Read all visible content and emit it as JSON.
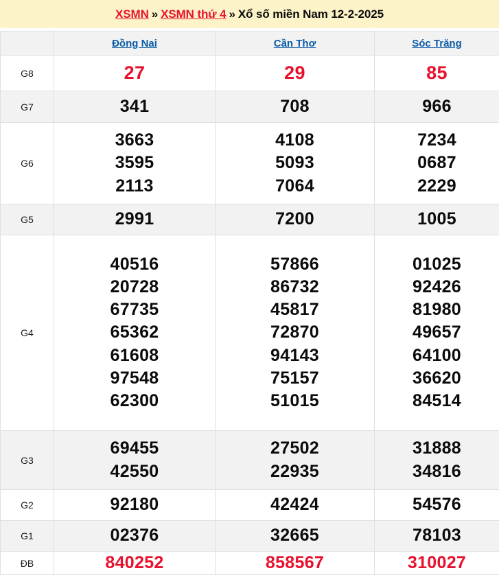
{
  "banner": {
    "link1": "XSMN",
    "sep1": "»",
    "link2": "XSMN thứ 4",
    "sep2": "»",
    "title": "Xổ số miền Nam 12-2-2025"
  },
  "colors": {
    "banner_bg": "#fdf3c8",
    "crumb_link": "#e8112d",
    "province_link": "#0b5ca8",
    "accent_number": "#e8112d",
    "number": "#0b0b0b",
    "row_alt_bg": "#f2f2f2",
    "row_bg": "#ffffff",
    "border": "#e0e0e0"
  },
  "table": {
    "corner_label": "",
    "provinces": [
      "Đồng Nai",
      "Cần Thơ",
      "Sóc Trăng"
    ],
    "rows": [
      {
        "label": "G8",
        "accent": true,
        "stripe": false,
        "values": [
          [
            "27"
          ],
          [
            "29"
          ],
          [
            "85"
          ]
        ]
      },
      {
        "label": "G7",
        "accent": false,
        "stripe": true,
        "values": [
          [
            "341"
          ],
          [
            "708"
          ],
          [
            "966"
          ]
        ]
      },
      {
        "label": "G6",
        "accent": false,
        "stripe": false,
        "values": [
          [
            "3663",
            "3595",
            "2113"
          ],
          [
            "4108",
            "5093",
            "7064"
          ],
          [
            "7234",
            "0687",
            "2229"
          ]
        ]
      },
      {
        "label": "G5",
        "accent": false,
        "stripe": true,
        "values": [
          [
            "2991"
          ],
          [
            "7200"
          ],
          [
            "1005"
          ]
        ]
      },
      {
        "label": "G4",
        "accent": false,
        "stripe": false,
        "values": [
          [
            "40516",
            "20728",
            "67735",
            "65362",
            "61608",
            "97548",
            "62300"
          ],
          [
            "57866",
            "86732",
            "45817",
            "72870",
            "94143",
            "75157",
            "51015"
          ],
          [
            "01025",
            "92426",
            "81980",
            "49657",
            "64100",
            "36620",
            "84514"
          ]
        ]
      },
      {
        "label": "G3",
        "accent": false,
        "stripe": true,
        "values": [
          [
            "69455",
            "42550"
          ],
          [
            "27502",
            "22935"
          ],
          [
            "31888",
            "34816"
          ]
        ]
      },
      {
        "label": "G2",
        "accent": false,
        "stripe": false,
        "values": [
          [
            "92180"
          ],
          [
            "42424"
          ],
          [
            "54576"
          ]
        ]
      },
      {
        "label": "G1",
        "accent": false,
        "stripe": true,
        "values": [
          [
            "02376"
          ],
          [
            "32665"
          ],
          [
            "78103"
          ]
        ]
      },
      {
        "label": "ĐB",
        "accent": true,
        "stripe": false,
        "values": [
          [
            "840252"
          ],
          [
            "858567"
          ],
          [
            "310027"
          ]
        ]
      }
    ]
  }
}
